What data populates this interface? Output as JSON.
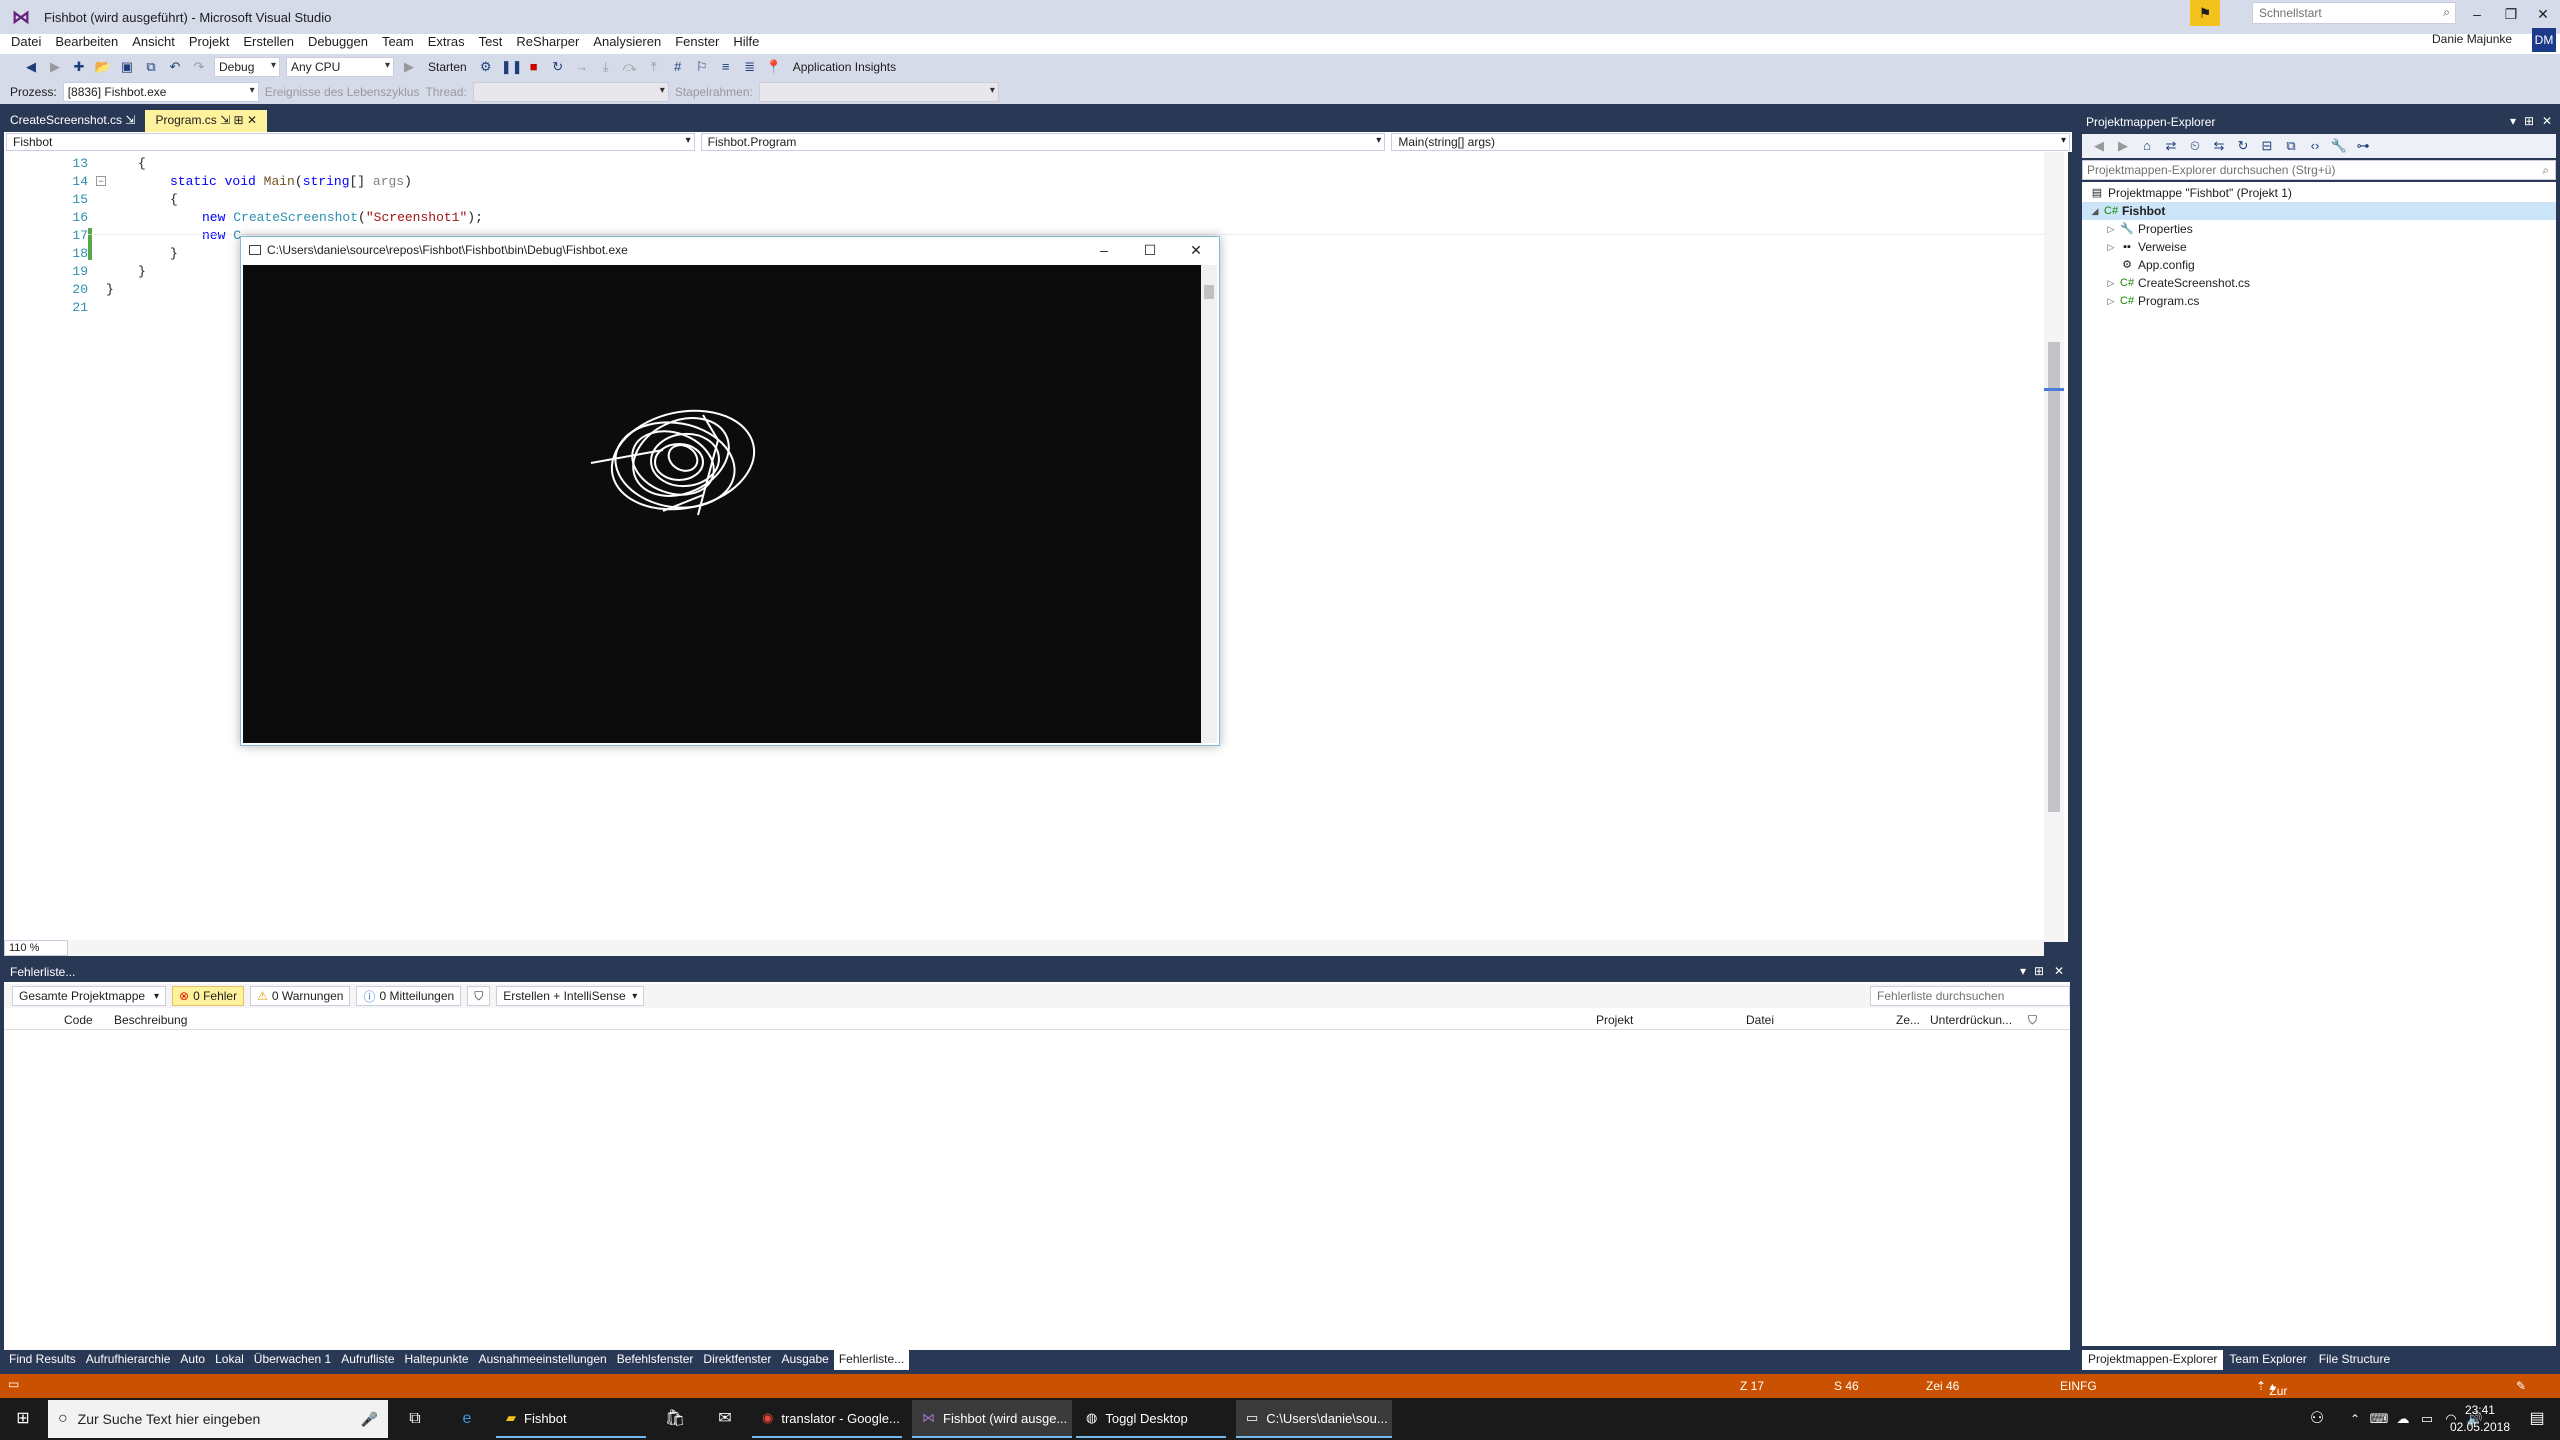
{
  "window": {
    "title": "Fishbot (wird ausgeführt) - Microsoft Visual Studio"
  },
  "quickstart": {
    "placeholder": "Schnellstart"
  },
  "user": {
    "name": "Danie Majunke",
    "initials": "DM"
  },
  "menu": [
    "Datei",
    "Bearbeiten",
    "Ansicht",
    "Projekt",
    "Erstellen",
    "Debuggen",
    "Team",
    "Extras",
    "Test",
    "ReSharper",
    "Analysieren",
    "Fenster",
    "Hilfe"
  ],
  "toolbar": {
    "config": "Debug",
    "platform": "Any CPU",
    "start": "Starten",
    "insights": "Application Insights",
    "process_label": "Prozess:",
    "process_value": "[8836] Fishbot.exe",
    "lifecycle": "Ereignisse des Lebenszyklus",
    "thread_label": "Thread:",
    "stack_label": "Stapelrahmen:"
  },
  "tabs": [
    {
      "label": "CreateScreenshot.cs",
      "active": false
    },
    {
      "label": "Program.cs",
      "active": true
    }
  ],
  "navbar": {
    "project": "Fishbot",
    "class": "Fishbot.Program",
    "member": "Main(string[] args)"
  },
  "code": {
    "lines": [
      "13",
      "14",
      "15",
      "16",
      "17",
      "18",
      "19",
      "20",
      "21"
    ],
    "l13": "{",
    "l14_kw1": "static",
    "l14_kw2": "void",
    "l14_mth": "Main",
    "l14_a": "(",
    "l14_kw3": "string",
    "l14_b": "[] ",
    "l14_par": "args",
    "l14_c": ")",
    "l15": "{",
    "l16_kw": "new",
    "l16_cls": "CreateScreenshot",
    "l16_a": "(",
    "l16_str": "\"Screenshot1\"",
    "l16_b": ");",
    "l17_kw": "new",
    "l17_rest": "C",
    "l18": "}",
    "l19": "}",
    "l20": "}"
  },
  "zoom": "110 %",
  "console": {
    "title": "C:\\Users\\danie\\source\\repos\\Fishbot\\Fishbot\\bin\\Debug\\Fishbot.exe"
  },
  "errorlist": {
    "title": "Fehlerliste...",
    "scope": "Gesamte Projektmappe",
    "errors": "0 Fehler",
    "warnings": "0 Warnungen",
    "messages": "0 Mitteilungen",
    "build": "Erstellen + IntelliSense",
    "search_placeholder": "Fehlerliste durchsuchen",
    "columns": {
      "code": "Code",
      "desc": "Beschreibung",
      "project": "Projekt",
      "file": "Datei",
      "line": "Ze...",
      "suppress": "Unterdrückun..."
    }
  },
  "bottom_tabs": [
    "Find Results",
    "Aufrufhierarchie",
    "Auto",
    "Lokal",
    "Überwachen 1",
    "Aufrufliste",
    "Haltepunkte",
    "Ausnahmeeinstellungen",
    "Befehlsfenster",
    "Direktfenster",
    "Ausgabe",
    "Fehlerliste..."
  ],
  "solution": {
    "title": "Projektmappen-Explorer",
    "search_placeholder": "Projektmappen-Explorer durchsuchen (Strg+ü)",
    "tree": [
      "Projektmappe \"Fishbot\" (Projekt 1)",
      "Fishbot",
      "Properties",
      "Verweise",
      "App.config",
      "CreateScreenshot.cs",
      "Program.cs"
    ],
    "tabs": [
      "Projektmappen-Explorer",
      "Team Explorer",
      "File Structure"
    ]
  },
  "status": {
    "line": "Z 17",
    "col": "S 46",
    "char": "Zei 46",
    "mode": "EINFG",
    "source_control": "Zur Quellcodeverwaltung hinzufügen"
  },
  "taskbar": {
    "search_placeholder": "Zur Suche Text hier eingeben",
    "items": [
      "Fishbot",
      "translator - Google...",
      "Fishbot (wird ausge...",
      "Toggl Desktop",
      "C:\\Users\\danie\\sou..."
    ],
    "time": "23:41",
    "date": "02.05.2018"
  },
  "colors": {
    "vs_blue": "#293955",
    "status_orange": "#ca5100",
    "tab_active": "#fff29d"
  }
}
